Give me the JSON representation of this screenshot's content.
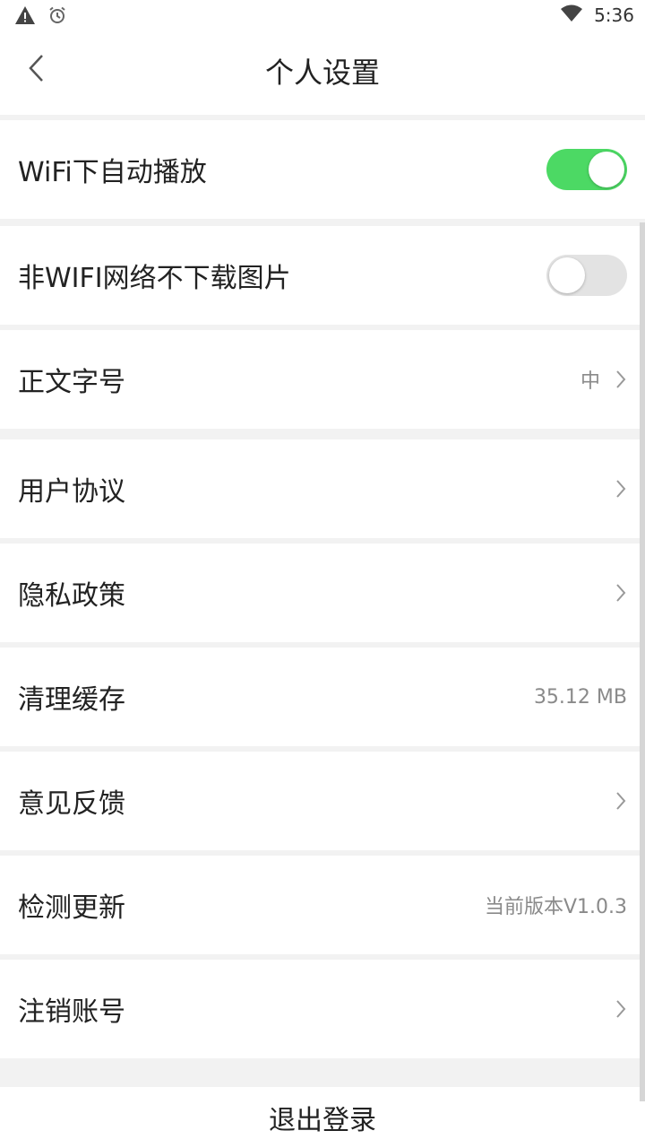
{
  "status_bar": {
    "time": "5:36",
    "icons": [
      "warning-icon",
      "alarm-icon",
      "wifi-icon"
    ]
  },
  "header": {
    "title": "个人设置",
    "back_icon": "chevron-left-icon"
  },
  "settings": {
    "wifi_autoplay": {
      "label": "WiFi下自动播放",
      "enabled": true
    },
    "no_image_non_wifi": {
      "label": "非WIFI网络不下载图片",
      "enabled": false
    },
    "font_size": {
      "label": "正文字号",
      "value": "中"
    },
    "user_agreement": {
      "label": "用户协议"
    },
    "privacy_policy": {
      "label": "隐私政策"
    },
    "clear_cache": {
      "label": "清理缓存",
      "value": "35.12 MB"
    },
    "feedback": {
      "label": "意见反馈"
    },
    "check_update": {
      "label": "检测更新",
      "value": "当前版本V1.0.3"
    },
    "delete_account": {
      "label": "注销账号"
    }
  },
  "logout": {
    "label": "退出登录"
  },
  "colors": {
    "toggle_on": "#4cd964",
    "toggle_off": "#e3e3e3",
    "value_text": "#8a8a8a"
  }
}
